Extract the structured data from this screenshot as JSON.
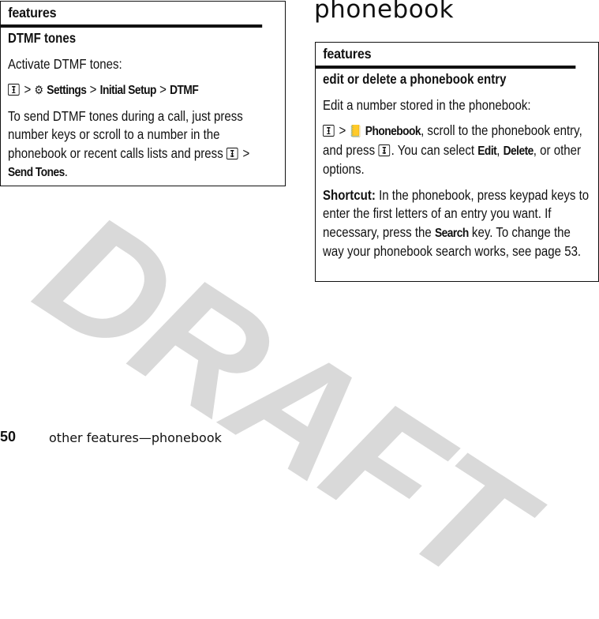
{
  "watermark": "DRAFT",
  "page_title": "phonebook",
  "left_box": {
    "header": "features",
    "title": "DTMF tones",
    "intro": "Activate DTMF tones:",
    "path": {
      "menu_icon": "menu-key-icon",
      "sep": ">",
      "settings_icon": "settings-icon",
      "settings_label": "Settings",
      "initial_setup": "Initial Setup",
      "dtmf": "DTMF"
    },
    "body_pre": "To send DTMF tones during a call, just press number keys or scroll to a number in the phonebook or recent calls lists and press",
    "body_sep": ">",
    "send_tones": "Send Tones",
    "body_end": "."
  },
  "right_box": {
    "header": "features",
    "title": "edit or delete a phonebook entry",
    "intro": "Edit a number stored in the phonebook:",
    "sep": ">",
    "phonebook_icon": "phonebook-icon",
    "phonebook_label": "Phonebook",
    "p2_a": ", scroll to the phonebook entry, and press",
    "p2_b": ". You can select",
    "edit_label": "Edit",
    "comma": ",",
    "delete_label": "Delete",
    "p2_c": ", or other options.",
    "shortcut_label": "Shortcut:",
    "shortcut_a": " In the phonebook, press keypad keys to enter the first letters of an entry you want. If necessary, press the",
    "search_label": "Search",
    "shortcut_b": " key. To change the way your phonebook search works, see page 53."
  },
  "footer": {
    "page_number": "50",
    "section": "other features—phonebook"
  }
}
